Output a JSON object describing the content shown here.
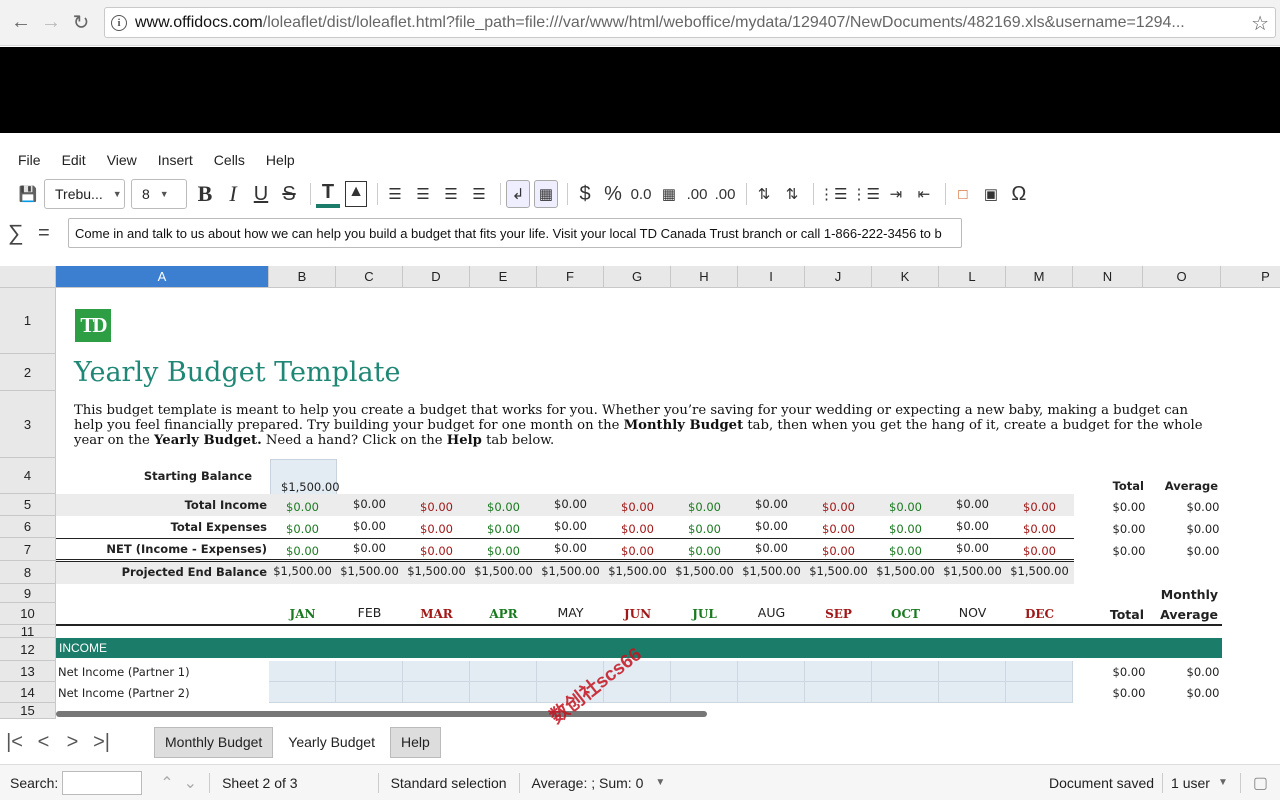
{
  "browser": {
    "url_host": "www.offidocs.com",
    "url_rest": "/loleaflet/dist/loleaflet.html?file_path=file:///var/www/html/weboffice/mydata/129407/NewDocuments/482169.xls&username=1294...",
    "back_icon": "arrow-left-icon",
    "forward_icon": "arrow-right-icon",
    "reload_icon": "reload-icon"
  },
  "menu": [
    "File",
    "Edit",
    "View",
    "Insert",
    "Cells",
    "Help"
  ],
  "toolbar": {
    "font_name": "Trebu...",
    "font_size": "8",
    "bold": "B",
    "italic": "I",
    "underline": "U",
    "strike": "S",
    "currency": "$",
    "percent": "%",
    "number": "0.0",
    "add_decimal": ".00",
    "remove_decimal": ".00",
    "special_char": "Ω"
  },
  "formula": {
    "sigma": "∑",
    "equals": "=",
    "value": "Come in and talk to us about how we can help you build a budget that fits your life. Visit your local TD Canada Trust branch or call 1-866-222-3456 to b"
  },
  "columns": [
    "A",
    "B",
    "C",
    "D",
    "E",
    "F",
    "G",
    "H",
    "I",
    "J",
    "K",
    "L",
    "M",
    "N",
    "O",
    "P"
  ],
  "rows": [
    "1",
    "2",
    "3",
    "4",
    "5",
    "6",
    "7",
    "8",
    "9",
    "10",
    "11",
    "12",
    "13",
    "14",
    "15"
  ],
  "sheet": {
    "logo": "TD",
    "title": "Yearly Budget Template",
    "desc_1": "This budget template is meant to help you create a budget that works for you. Whether you’re saving for your wedding or expecting a new baby, making a budget can help you feel financially prepared. Try building your budget for one month on the ",
    "desc_bold_1": "Monthly Budget",
    "desc_2": " tab, then when you get the hang of it, create a budget for the whole year on the ",
    "desc_bold_2": "Yearly Budget.",
    "desc_3": " Need a hand? Click on the ",
    "desc_bold_3": "Help",
    "desc_4": " tab below.",
    "starting_balance_label": "Starting Balance",
    "starting_balance": "$1,500.00",
    "total_header": "Total",
    "average_header": "Average",
    "monthly_header": "Monthly",
    "row_labels": [
      "Total Income",
      "Total Expenses",
      "NET (Income - Expenses)",
      "Projected End Balance"
    ],
    "month_value": "$0.00",
    "projected_value": "$1,500.00",
    "months": [
      "JAN",
      "FEB",
      "MAR",
      "APR",
      "MAY",
      "JUN",
      "JUL",
      "AUG",
      "SEP",
      "OCT",
      "NOV",
      "DEC"
    ],
    "income_label": "INCOME",
    "income_rows": [
      "Net Income  (Partner 1)",
      "Net Income (Partner 2)"
    ]
  },
  "tabs": {
    "items": [
      "Monthly Budget",
      "Yearly Budget",
      "Help"
    ],
    "active": "Yearly Budget"
  },
  "status": {
    "search_label": "Search:",
    "sheet": "Sheet 2 of 3",
    "selection": "Standard selection",
    "sum": "Average: ; Sum: 0",
    "saved": "Document saved",
    "users": "1 user"
  },
  "watermark": "数创社scs66",
  "colors": {
    "accent_teal": "#1c7c6a",
    "title_teal": "#1f8775",
    "green": "#1a7a20",
    "red": "#a01818",
    "selection_blue": "#3c7fd1"
  }
}
